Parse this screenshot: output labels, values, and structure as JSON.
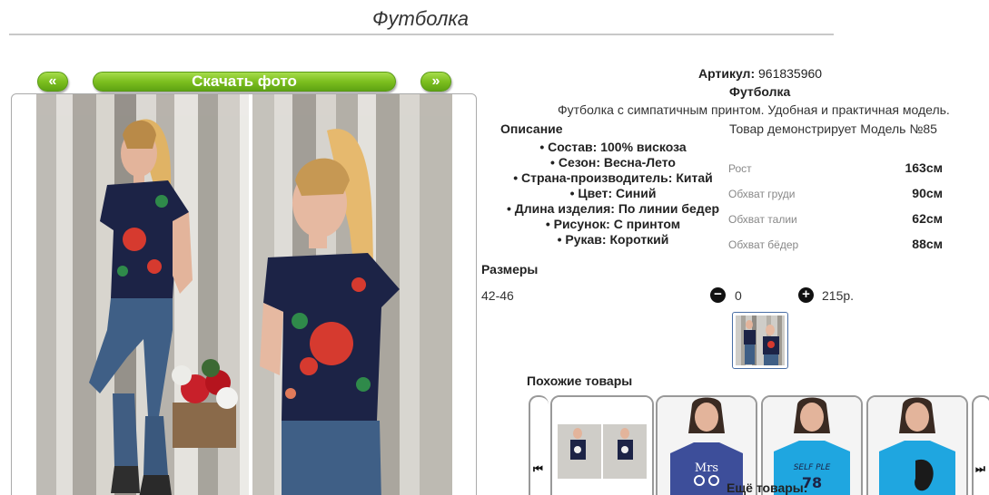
{
  "page": {
    "title": "Футболка"
  },
  "gallery": {
    "prev_label": "«",
    "next_label": "»",
    "download_label": "Скачать фото"
  },
  "product": {
    "article_label": "Артикул:",
    "article_value": "961835960",
    "name": "Футболка",
    "description": "Футболка с симпатичным принтом. Удобная и практичная модель.",
    "specs_title": "Описание",
    "specs": [
      "Состав: 100% вискоза",
      "Сезон: Весна-Лето",
      "Страна-производитель: Китай",
      "Цвет: Синий",
      "Длина изделия: По линии бедер",
      "Рисунок: С принтом",
      "Рукав: Короткий"
    ]
  },
  "model": {
    "caption": "Товар демонстрирует Модель №85",
    "measurements": [
      {
        "label": "Рост",
        "value": "163см"
      },
      {
        "label": "Обхват груди",
        "value": "90см"
      },
      {
        "label": "Обхват талии",
        "value": "62см"
      },
      {
        "label": "Обхват бёдер",
        "value": "88см"
      }
    ]
  },
  "sizes": {
    "title": "Размеры",
    "size": "42-46",
    "minus_icon": "minus-circle-icon",
    "quantity": "0",
    "plus_icon": "plus-circle-icon",
    "price": "215р."
  },
  "similar": {
    "title": "Похожие товары",
    "prev_icon": "skip-back-icon",
    "next_icon": "skip-forward-icon",
    "cards": [
      {
        "print": ""
      },
      {
        "print": "Mrs"
      },
      {
        "print": "SELF PLE 78"
      },
      {
        "print": ""
      }
    ]
  },
  "more": {
    "title": "Ещё товары:"
  },
  "colors": {
    "accent_green": "#7cbf1f",
    "shirt_navy": "#1c2346",
    "shirt_cyan": "#1fa6e0"
  }
}
